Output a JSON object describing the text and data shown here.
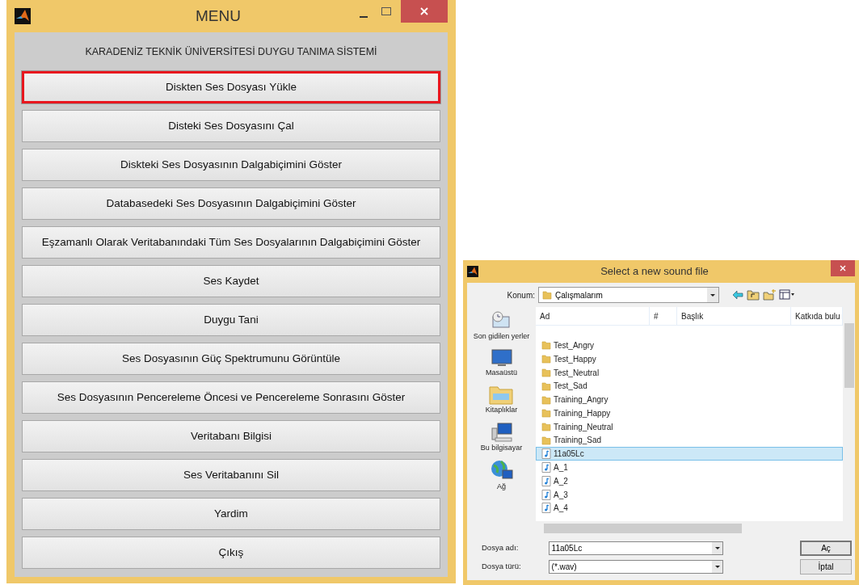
{
  "menu_window": {
    "title": "MENU",
    "heading": "KARADENİZ TEKNİK ÜNİVERSİTESİ DUYGU TANIMA SİSTEMİ",
    "buttons": [
      {
        "label": "Diskten Ses Dosyası Yükle",
        "focused": true
      },
      {
        "label": "Disteki Ses Dosyasını Çal",
        "focused": false
      },
      {
        "label": "Diskteki Ses Dosyasının Dalgabiçimini Göster",
        "focused": false
      },
      {
        "label": "Databasedeki Ses Dosyasının Dalgabiçimini Göster",
        "focused": false
      },
      {
        "label": "Eşzamanlı Olarak Veritabanındaki Tüm Ses Dosyalarının Dalgabiçimini Göster",
        "focused": false
      },
      {
        "label": "Ses Kaydet",
        "focused": false
      },
      {
        "label": "Duygu Tani",
        "focused": false
      },
      {
        "label": "Ses Dosyasının Güç Spektrumunu Görüntüle",
        "focused": false
      },
      {
        "label": "Ses Dosyasının Pencereleme Öncesi ve Pencereleme Sonrasını Göster",
        "focused": false
      },
      {
        "label": "Veritabanı Bilgisi",
        "focused": false
      },
      {
        "label": "Ses Veritabanını Sil",
        "focused": false
      },
      {
        "label": "Yardim",
        "focused": false
      },
      {
        "label": "Çıkış",
        "focused": false
      }
    ]
  },
  "file_dialog": {
    "title": "Select a new sound file",
    "location_label": "Konum:",
    "location": "Çalışmalarım",
    "places": [
      {
        "label": "Son gidilen yerler",
        "kind": "recent"
      },
      {
        "label": "Masaüstü",
        "kind": "desktop"
      },
      {
        "label": "Kitaplıklar",
        "kind": "libraries"
      },
      {
        "label": "Bu bilgisayar",
        "kind": "computer"
      },
      {
        "label": "Ağ",
        "kind": "network"
      }
    ],
    "columns": [
      "Ad",
      "#",
      "Başlık",
      "Katkıda bulu"
    ],
    "files": [
      {
        "name": "Test_Angry",
        "kind": "folder",
        "selected": false
      },
      {
        "name": "Test_Happy",
        "kind": "folder",
        "selected": false
      },
      {
        "name": "Test_Neutral",
        "kind": "folder",
        "selected": false
      },
      {
        "name": "Test_Sad",
        "kind": "folder",
        "selected": false
      },
      {
        "name": "Training_Angry",
        "kind": "folder",
        "selected": false
      },
      {
        "name": "Training_Happy",
        "kind": "folder",
        "selected": false
      },
      {
        "name": "Training_Neutral",
        "kind": "folder",
        "selected": false
      },
      {
        "name": "Training_Sad",
        "kind": "folder",
        "selected": false
      },
      {
        "name": "11a05Lc",
        "kind": "audio",
        "selected": true
      },
      {
        "name": "A_1",
        "kind": "audio",
        "selected": false
      },
      {
        "name": "A_2",
        "kind": "audio",
        "selected": false
      },
      {
        "name": "A_3",
        "kind": "audio",
        "selected": false
      },
      {
        "name": "A_4",
        "kind": "audio",
        "selected": false
      }
    ],
    "filename_label": "Dosya adı:",
    "filename": "11a05Lc",
    "filetype_label": "Dosya türü:",
    "filetype": "(*.wav)",
    "open_button": "Aç",
    "cancel_button": "İptal"
  }
}
